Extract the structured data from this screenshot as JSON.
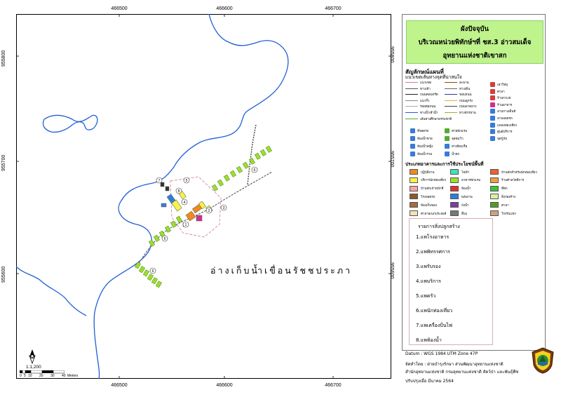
{
  "map": {
    "x_ticks": [
      "466500",
      "466600",
      "466700"
    ],
    "y_ticks": [
      "955800",
      "955700",
      "955600"
    ],
    "reservoir_label": "อ่างเก็บน้ำเขื่อนรัชชประภา",
    "building_numbers": [
      "1",
      "2",
      "3",
      "4",
      "5",
      "6",
      "7",
      "8"
    ],
    "scale_ratio": "1:1,200",
    "scale_ticks": [
      "0",
      "5",
      "10",
      "20",
      "30",
      "40",
      "Meters"
    ],
    "colors": {
      "water_line": "#1f5fd6",
      "building_green": "#9be02e",
      "building_yellow": "#f7f34a",
      "building_orange": "#f08a1f",
      "building_blue": "#2b7fd8",
      "boundary": "#d4869b"
    }
  },
  "title": {
    "line1": "ผังปัจจุบัน",
    "line2": "บริเวณหน่วยพิทักษ์ฯที่ ชส.3 อ่าวสมเด็จ",
    "line3": "อุทยานแห่งชาติเขาสก"
  },
  "legend": {
    "heading": "สัญลักษณ์แผนที่",
    "subheading": "แนวเขตเส้นทางจุดที่น่าสนใจ",
    "lines": [
      {
        "label": "แนวเขต",
        "color": "#d87a95"
      },
      {
        "label": "ทางเท้า",
        "color": "#555555"
      },
      {
        "label": "ถนนคอนกรีต",
        "color": "#222222"
      },
      {
        "label": "แนวรั้ว",
        "color": "#888888"
      },
      {
        "label": "รอยต่อถนน",
        "color": "#aaaaaa"
      },
      {
        "label": "ทางน้ำ/ลำน้ำ",
        "color": "#1f5fd6"
      },
      {
        "label": "เส้นทางศึกษาธรรมชาติ",
        "color": "#55aa33"
      },
      {
        "label": "สะพาน",
        "color": "#994400"
      },
      {
        "label": "ทางเดิน",
        "color": "#666666"
      },
      {
        "label": "ขอบถนน",
        "color": "#333399"
      },
      {
        "label": "ถนนลูกรัง",
        "color": "#e0b040"
      },
      {
        "label": "ถนนลาดยาง",
        "color": "#444444"
      },
      {
        "label": "ทางจักรยาน",
        "color": "#aaaa33"
      }
    ],
    "points": [
      {
        "label": "ที่จอดรถ",
        "color": "#3a7bd5"
      },
      {
        "label": "ห้องน้ำชาย",
        "color": "#3a7bd5"
      },
      {
        "label": "ห้องน้ำหญิง",
        "color": "#3a7bd5"
      },
      {
        "label": "ห้องน้ำรวม",
        "color": "#3a7bd5"
      },
      {
        "label": "ค่ายพักแรม",
        "color": "#55aa33"
      },
      {
        "label": "จุดชมวิว",
        "color": "#55aa33"
      },
      {
        "label": "ท่าเทียบเรือ",
        "color": "#3a7bd5"
      },
      {
        "label": "น้ำตก",
        "color": "#3a7bd5"
      },
      {
        "label": "เสาวิทยุ",
        "color": "#d04040"
      },
      {
        "label": "ศาลา",
        "color": "#d04040"
      },
      {
        "label": "ร้านกาแฟ",
        "color": "#d04040"
      },
      {
        "label": "ร้านอาหาร",
        "color": "#d03090"
      },
      {
        "label": "ลานกางเต็นท์",
        "color": "#3a7bd5"
      },
      {
        "label": "ลานจอดรถ",
        "color": "#3a7bd5"
      },
      {
        "label": "แหล่งท่องเที่ยว",
        "color": "#3a7bd5"
      },
      {
        "label": "ศูนย์บริการ",
        "color": "#3a7bd5"
      },
      {
        "label": "จุดกู้ภัย",
        "color": "#3a7bd5"
      }
    ],
    "landuse_heading": "ประเภทอาคารและการใช้ประโยชน์พื้นที่",
    "landuse": [
      {
        "label": "ปฏิบัติงาน",
        "color": "#f08a1f"
      },
      {
        "label": "บริการนักท่องเที่ยว",
        "color": "#f7f34a"
      },
      {
        "label": "บ้านพักเจ้าหน้าที่",
        "color": "#f4a6a6"
      },
      {
        "label": "โรงจอดรถ",
        "color": "#8a5a2b"
      },
      {
        "label": "ห้องเก็บของ",
        "color": "#a86b3c"
      },
      {
        "label": "ศาลาอเนกประสงค์",
        "color": "#f6e0b8"
      },
      {
        "label": "ไฟฟ้า",
        "color": "#40e0c0"
      },
      {
        "label": "อาคารพักแรม",
        "color": "#9be02e"
      },
      {
        "label": "ห้องน้ำ",
        "color": "#e03030"
      },
      {
        "label": "พลังงาน",
        "color": "#2b7fd8"
      },
      {
        "label": "ถังน้ำ",
        "color": "#7a3fa0"
      },
      {
        "label": "อื่นๆ",
        "color": "#777777"
      },
      {
        "label": "บ้านพักสำหรับนักท่องเที่ยว",
        "color": "#f06030"
      },
      {
        "label": "ร้านค้าสวัสดิการ",
        "color": "#f0a040"
      },
      {
        "label": "ที่พัก",
        "color": "#40c040"
      },
      {
        "label": "สิ่งก่อสร้าง",
        "color": "#d8f0a0"
      },
      {
        "label": "ศาลา",
        "color": "#50a020"
      },
      {
        "label": "โรงรับแขก",
        "color": "#d0a080"
      }
    ]
  },
  "buildings": {
    "title": "รายการสิ่งปลูกสร้าง",
    "items": [
      "1.แพโรงอาหาร",
      "2.แพพิทรรศการ",
      "3.แพรับรอง",
      "4.แพบริการ",
      "5.แพครัว",
      "6.แพนักท่องเที่ยว",
      "7.แพเครื่องปั่นไฟ",
      "8.แพห้องน้ำ"
    ]
  },
  "footer": {
    "datum": "Datum : WGS 1984 UTM Zone 47P",
    "made_by": "จัดทำโดย : ฝ่ายบำรุงรักษา ส่วนพัฒนาอุทยานแห่งชาติ",
    "office": "สำนักอุทยานแห่งชาติ  กรมอุทยานแห่งชาติ สัตว์ป่า และพันธุ์พืช",
    "updated": "ปรับปรุงเมื่อ มีนาคม 2564"
  }
}
